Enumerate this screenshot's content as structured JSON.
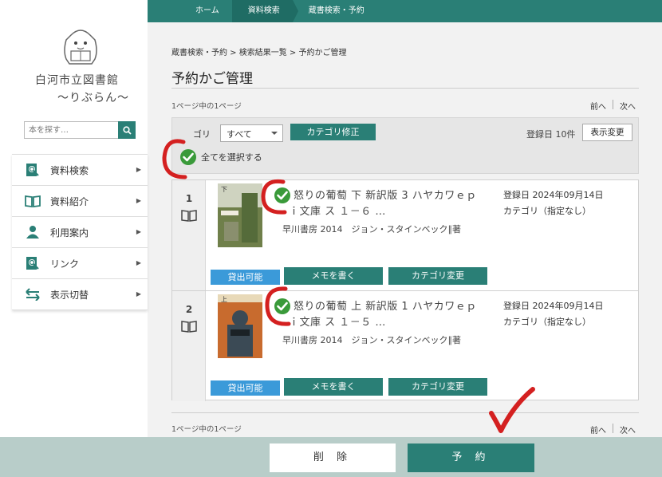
{
  "nav": {
    "crumbs": [
      "ホーム",
      "資料検索",
      "蔵書検索・予約"
    ]
  },
  "sidebar": {
    "library_name": "白河市立図書館",
    "library_sub": "〜りぶらん〜",
    "search_placeholder": "本を探す…",
    "menu": [
      {
        "label": "資料検索",
        "icon": "search-book-icon"
      },
      {
        "label": "資料紹介",
        "icon": "open-book-icon"
      },
      {
        "label": "利用案内",
        "icon": "person-icon"
      },
      {
        "label": "リンク",
        "icon": "link-search-icon"
      },
      {
        "label": "表示切替",
        "icon": "swap-arrows-icon"
      }
    ]
  },
  "breadcrumb": "蔵書検索・予約 > 検索結果一覧 > 予約かご管理",
  "page_title": "予約かご管理",
  "page_count": "1ページ中の1ページ",
  "pager": {
    "prev": "前へ",
    "next": "次へ"
  },
  "toolbar": {
    "category_label": "ゴリ",
    "category_value": "すべて",
    "category_fix_button": "カテゴリ修正",
    "registered_count": "登録日 10件",
    "display_change_button": "表示変更",
    "select_all_label": "全てを選択する"
  },
  "items": [
    {
      "number": "1",
      "title_line1": "怒りの葡萄 下 新訳版 3 ハヤカワｅｐ",
      "title_line2": "ｉ文庫 ス １－６ …",
      "publisher": "早川書房 2014　ジョン・スタインベック∥著",
      "reg_date": "登録日 2024年09月14日",
      "category": "カテゴリ（指定なし）",
      "availability": "貸出可能",
      "memo_button": "メモを書く",
      "category_change_button": "カテゴリ変更"
    },
    {
      "number": "2",
      "title_line1": "怒りの葡萄 上 新訳版 1 ハヤカワｅｐ",
      "title_line2": "ｉ文庫 ス １－５ …",
      "publisher": "早川書房 2014　ジョン・スタインベック∥著",
      "reg_date": "登録日 2024年09月14日",
      "category": "カテゴリ（指定なし）",
      "availability": "貸出可能",
      "memo_button": "メモを書く",
      "category_change_button": "カテゴリ変更"
    }
  ],
  "footer": {
    "delete_button": "削 除",
    "reserve_button": "予 約"
  },
  "colors": {
    "accent": "#2a7f76",
    "available": "#3b9ad9",
    "annotation": "#d42020",
    "check": "#3a9a3a"
  }
}
